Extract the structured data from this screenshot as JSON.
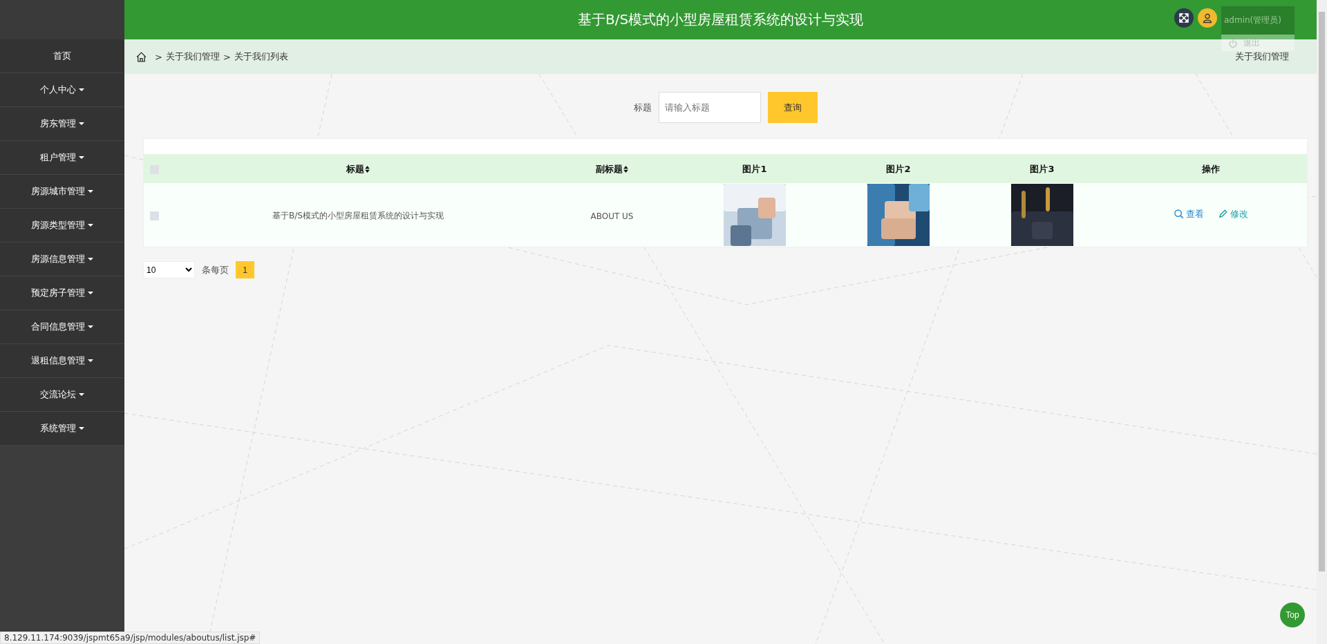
{
  "header": {
    "title": "基于B/S模式的小型房屋租赁系统的设计与实现",
    "user": "admin(管理员)",
    "logout": "退出"
  },
  "sidebar": {
    "items": [
      {
        "label": "首页",
        "has_caret": false
      },
      {
        "label": "个人中心",
        "has_caret": true
      },
      {
        "label": "房东管理",
        "has_caret": true
      },
      {
        "label": "租户管理",
        "has_caret": true
      },
      {
        "label": "房源城市管理",
        "has_caret": true
      },
      {
        "label": "房源类型管理",
        "has_caret": true
      },
      {
        "label": "房源信息管理",
        "has_caret": true
      },
      {
        "label": "预定房子管理",
        "has_caret": true
      },
      {
        "label": "合同信息管理",
        "has_caret": true
      },
      {
        "label": "退租信息管理",
        "has_caret": true
      },
      {
        "label": "交流论坛",
        "has_caret": true
      },
      {
        "label": "系统管理",
        "has_caret": true
      }
    ]
  },
  "breadcrumb": {
    "separator": ">",
    "items": [
      "关于我们管理",
      "关于我们列表"
    ],
    "page_title": "关于我们管理"
  },
  "search": {
    "label": "标题",
    "placeholder": "请输入标题",
    "button": "查询"
  },
  "table": {
    "select_all_checked": false,
    "columns": [
      {
        "label": "标题",
        "sortable": true
      },
      {
        "label": "副标题",
        "sortable": true
      },
      {
        "label": "图片1",
        "sortable": false
      },
      {
        "label": "图片2",
        "sortable": false
      },
      {
        "label": "图片3",
        "sortable": false
      },
      {
        "label": "操作",
        "sortable": false
      }
    ],
    "rows": [
      {
        "checked": false,
        "title": "基于B/S模式的小型房屋租赁系统的设计与实现",
        "subtitle": "ABOUT US",
        "images": [
          {
            "kind": "picture"
          },
          {
            "kind": "picture"
          },
          {
            "kind": "picture"
          }
        ],
        "actions": [
          {
            "kind": "view",
            "label": "查看"
          },
          {
            "kind": "edit",
            "label": "修改"
          }
        ]
      }
    ]
  },
  "pagination": {
    "page_size": "10",
    "label": "条每页",
    "pages": [
      {
        "label": "1",
        "selected": true
      }
    ]
  },
  "status_bar": "8.129.11.174:9039/jspmt65a9/jsp/modules/aboutus/list.jsp#",
  "top_button": "Top"
}
